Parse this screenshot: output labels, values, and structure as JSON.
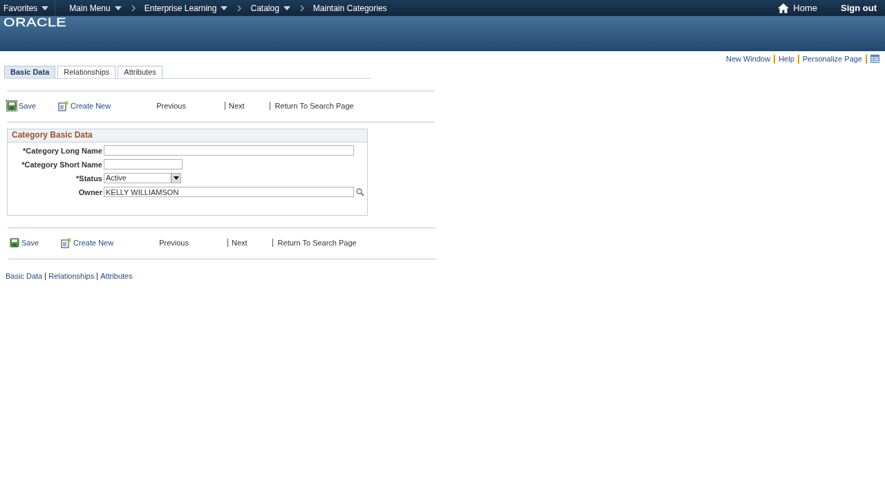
{
  "nav": {
    "items": [
      {
        "label": "Favorites",
        "kind": "menu"
      },
      {
        "label": "Main Menu",
        "kind": "menu"
      },
      {
        "label": "Enterprise Learning",
        "kind": "crumb-menu"
      },
      {
        "label": "Catalog",
        "kind": "crumb-menu"
      },
      {
        "label": "Maintain Categories",
        "kind": "crumb"
      }
    ],
    "home": "Home",
    "signout": "Sign out"
  },
  "logo": "ORACLE",
  "page_links": [
    "New Window",
    "Help",
    "Personalize Page"
  ],
  "tabs": [
    {
      "label": "Basic Data",
      "selected": true
    },
    {
      "label": "Relationships",
      "selected": false
    },
    {
      "label": "Attributes",
      "selected": false
    }
  ],
  "toolbar_top": [
    {
      "label": "Save",
      "kind": "save"
    },
    {
      "label": "Create New",
      "kind": "create"
    },
    {
      "label": "Previous",
      "kind": "plain"
    },
    {
      "label": "Next",
      "kind": "plain"
    },
    {
      "label": "Return To Search Page",
      "kind": "plain"
    }
  ],
  "section": {
    "title": "Category Basic Data",
    "fields": [
      {
        "label": "*Category Long Name",
        "kind": "text-long"
      },
      {
        "label": "*Category Short Name",
        "kind": "text-short"
      },
      {
        "label": "*Status",
        "value": "Active",
        "kind": "select"
      },
      {
        "label": "Owner",
        "value": "KELLY WILLIAMSON",
        "kind": "lookup"
      }
    ]
  },
  "toolbar_bottom": [
    {
      "label": "Save",
      "kind": "save"
    },
    {
      "label": "Create New",
      "kind": "create"
    },
    {
      "label": "Previous",
      "kind": "plain"
    },
    {
      "label": "Next",
      "kind": "plain"
    },
    {
      "label": "Return To Search Page",
      "kind": "plain"
    }
  ],
  "bottom_links": [
    "Basic Data",
    "Relationships",
    "Attributes"
  ]
}
